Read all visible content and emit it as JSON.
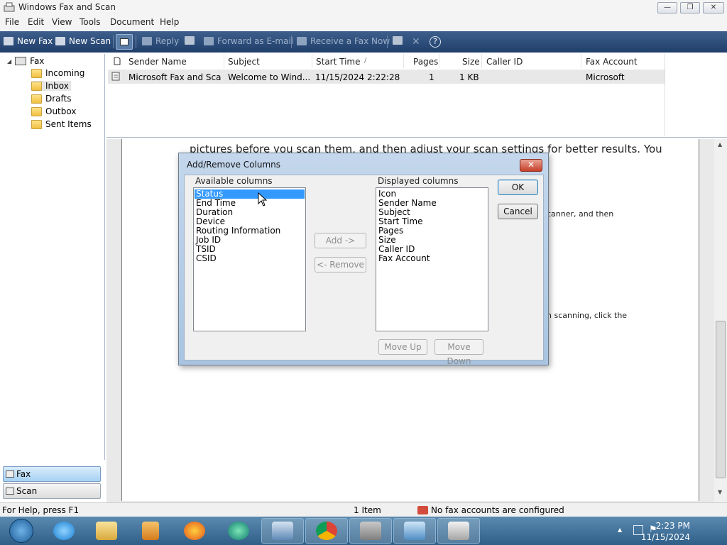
{
  "window": {
    "title": "Windows Fax and Scan",
    "controls": {
      "minimize": "—",
      "restore": "❐",
      "close": "✕"
    }
  },
  "menu": [
    "File",
    "Edit",
    "View",
    "Tools",
    "Document",
    "Help"
  ],
  "toolbar": {
    "new_fax": "New Fax",
    "new_scan": "New Scan",
    "reply": "Reply",
    "forward": "Forward as E-mail",
    "receive": "Receive a Fax Now"
  },
  "tree": {
    "root": "Fax",
    "folders": [
      "Incoming",
      "Inbox",
      "Drafts",
      "Outbox",
      "Sent Items"
    ],
    "selected": "Inbox"
  },
  "nav": {
    "fax": "Fax",
    "scan": "Scan"
  },
  "list": {
    "columns": [
      "Sender Name",
      "Subject",
      "Start Time",
      "Pages",
      "Size",
      "Caller ID",
      "Fax Account"
    ],
    "sort_indicator": "/",
    "rows": [
      {
        "sender": "Microsoft Fax and Sca...",
        "subject": "Welcome to Wind...",
        "start": "11/15/2024 2:22:28 P...",
        "pages": "1",
        "size": "1 KB",
        "caller": "",
        "account": "Microsoft"
      }
    ]
  },
  "preview": {
    "line1": "pictures before you scan them, and then adjust your scan settings for better results. You",
    "frag1": "canner, and then",
    "frag2": "n scanning, click the"
  },
  "status": {
    "help": "For Help, press F1",
    "items": "1 Item",
    "fax_accounts": "No fax accounts are configured"
  },
  "dialog": {
    "title": "Add/Remove Columns",
    "close": "✕",
    "available_label": "Available columns",
    "available": [
      "Status",
      "End Time",
      "Duration",
      "Device",
      "Routing Information",
      "Job ID",
      "TSID",
      "CSID"
    ],
    "available_selected": "Status",
    "displayed_label": "Displayed columns",
    "displayed": [
      "Icon",
      "Sender Name",
      "Subject",
      "Start Time",
      "Pages",
      "Size",
      "Caller ID",
      "Fax Account"
    ],
    "add": "Add ->",
    "remove": "<- Remove",
    "ok": "OK",
    "cancel": "Cancel",
    "move_up": "Move Up",
    "move_down": "Move Down"
  },
  "taskbar": {
    "items": [
      "start-orb",
      "internet-explorer",
      "windows-explorer",
      "media-player",
      "firefox",
      "edge",
      "fax-app",
      "chrome",
      "file-cabinet",
      "control-panel",
      "fax-scan-active"
    ],
    "time": "2:23 PM",
    "date": "11/15/2024"
  },
  "colors": {
    "toolbar_top": "#3e5f8c",
    "selection": "#3399ff",
    "taskbar": "#2f5f88"
  }
}
